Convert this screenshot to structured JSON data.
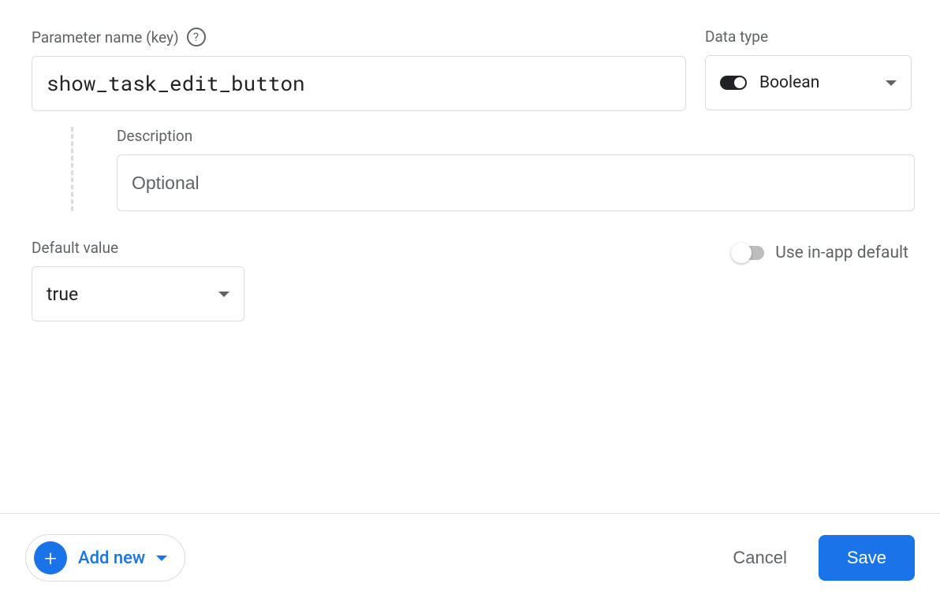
{
  "parameterName": {
    "label": "Parameter name (key)",
    "value": "show_task_edit_button"
  },
  "dataType": {
    "label": "Data type",
    "selected": "Boolean"
  },
  "description": {
    "label": "Description",
    "placeholder": "Optional",
    "value": ""
  },
  "defaultValue": {
    "label": "Default value",
    "selected": "true"
  },
  "inAppDefault": {
    "label": "Use in-app default",
    "enabled": false
  },
  "footer": {
    "addNew": "Add new",
    "cancel": "Cancel",
    "save": "Save"
  }
}
